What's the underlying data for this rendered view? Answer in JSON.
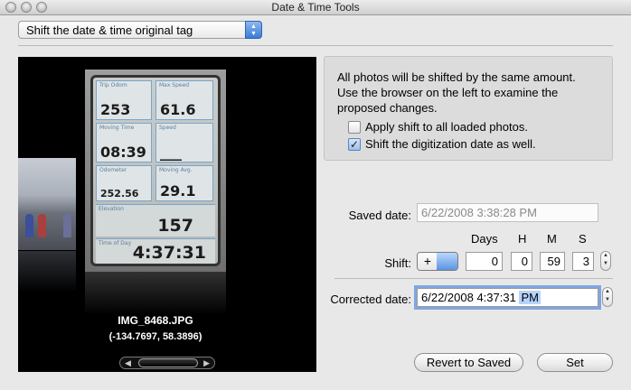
{
  "window": {
    "title": "Date & Time Tools"
  },
  "mode_popup": {
    "selected": "Shift the date & time original tag"
  },
  "browser": {
    "filename": "IMG_8468.JPG",
    "coordinates": "(-134.7697, 58.3896)",
    "gps_screen": {
      "trip_odom_caption": "Trip Odom",
      "trip_odom_value": "253",
      "max_speed_caption": "Max Speed",
      "max_speed_value": "61.6",
      "moving_time_caption": "Moving Time",
      "moving_time_value": "08:39",
      "speed_caption": "Speed",
      "speed_value": "___",
      "odometer_caption": "Odometer",
      "odometer_value": "252.56",
      "moving_avg_caption": "Moving Avg.",
      "moving_avg_value": "29.1",
      "elevation_caption": "Elevation",
      "elevation_value": "157",
      "time_of_day_caption": "Time of Day",
      "time_of_day_value": "4:37:31"
    }
  },
  "info": {
    "message": "All photos will be shifted by the same amount. Use the browser on the left to examine the proposed changes.",
    "apply_all_label": "Apply shift to all loaded photos.",
    "apply_all_checked": false,
    "digitization_label": "Shift the digitization date as well.",
    "digitization_checked": true
  },
  "dates": {
    "saved_label": "Saved date:",
    "saved_value": "6/22/2008   3:38:28 PM",
    "shift_label": "Shift:",
    "col_days": "Days",
    "col_h": "H",
    "col_m": "M",
    "col_s": "S",
    "plus": "+",
    "minus": "−",
    "days_value": "0",
    "h_value": "0",
    "m_value": "59",
    "s_value": "3",
    "corrected_label": "Corrected date:",
    "corrected_value": "6/22/2008   4:37:31 ",
    "corrected_ampm": "PM"
  },
  "buttons": {
    "revert": "Revert to Saved",
    "set": "Set"
  }
}
